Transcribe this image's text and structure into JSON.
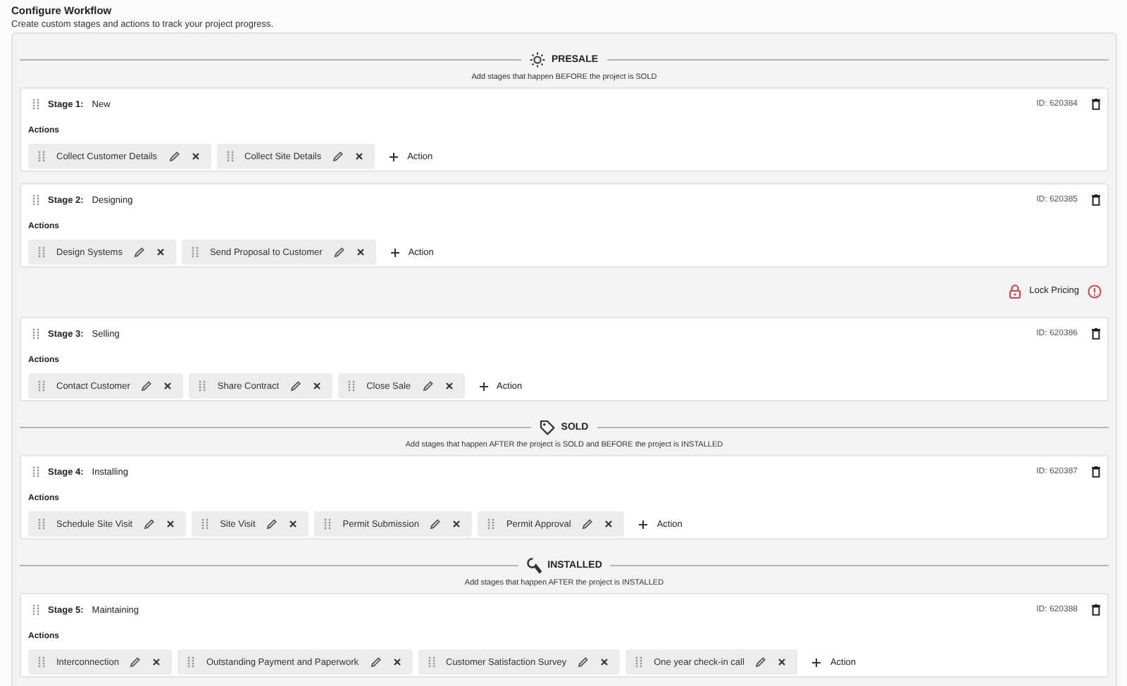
{
  "header": {
    "title": "Configure Workflow",
    "subtitle": "Create custom stages and actions to track your project progress."
  },
  "workflow": [
    {
      "kind": "phase",
      "label": "PRESALE",
      "note": "Add stages that happen BEFORE the project is SOLD"
    },
    {
      "kind": "stage",
      "stage_label": "Stage 1:",
      "name": "New",
      "id": "ID: 620384",
      "actions_label": "Actions",
      "actions": [
        "Collect Customer Details",
        "Collect Site Details"
      ],
      "add_label": "Action"
    },
    {
      "kind": "stage",
      "stage_label": "Stage 2:",
      "name": "Designing",
      "id": "ID: 620385",
      "actions_label": "Actions",
      "actions": [
        "Design Systems",
        "Send Proposal to Customer"
      ],
      "add_label": "Action"
    },
    {
      "kind": "lock",
      "label": "Lock Pricing"
    },
    {
      "kind": "stage",
      "stage_label": "Stage 3:",
      "name": "Selling",
      "id": "ID: 620386",
      "actions_label": "Actions",
      "actions": [
        "Contact Customer",
        "Share Contract",
        "Close Sale"
      ],
      "add_label": "Action"
    },
    {
      "kind": "phase",
      "label": "SOLD",
      "note": "Add stages that happen AFTER the project is SOLD and BEFORE the project is INSTALLED"
    },
    {
      "kind": "stage",
      "stage_label": "Stage 4:",
      "name": "Installing",
      "id": "ID: 620387",
      "actions_label": "Actions",
      "actions": [
        "Schedule Site Visit",
        "Site Visit",
        "Permit Submission",
        "Permit Approval"
      ],
      "add_label": "Action"
    },
    {
      "kind": "phase",
      "label": "INSTALLED",
      "note": "Add stages that happen AFTER the project is INSTALLED"
    },
    {
      "kind": "stage",
      "stage_label": "Stage 5:",
      "name": "Maintaining",
      "id": "ID: 620388",
      "actions_label": "Actions",
      "actions": [
        "Interconnection",
        "Outstanding Payment and Paperwork",
        "Customer Satisfaction Survey",
        "One year check-in call"
      ],
      "add_label": "Action"
    }
  ]
}
